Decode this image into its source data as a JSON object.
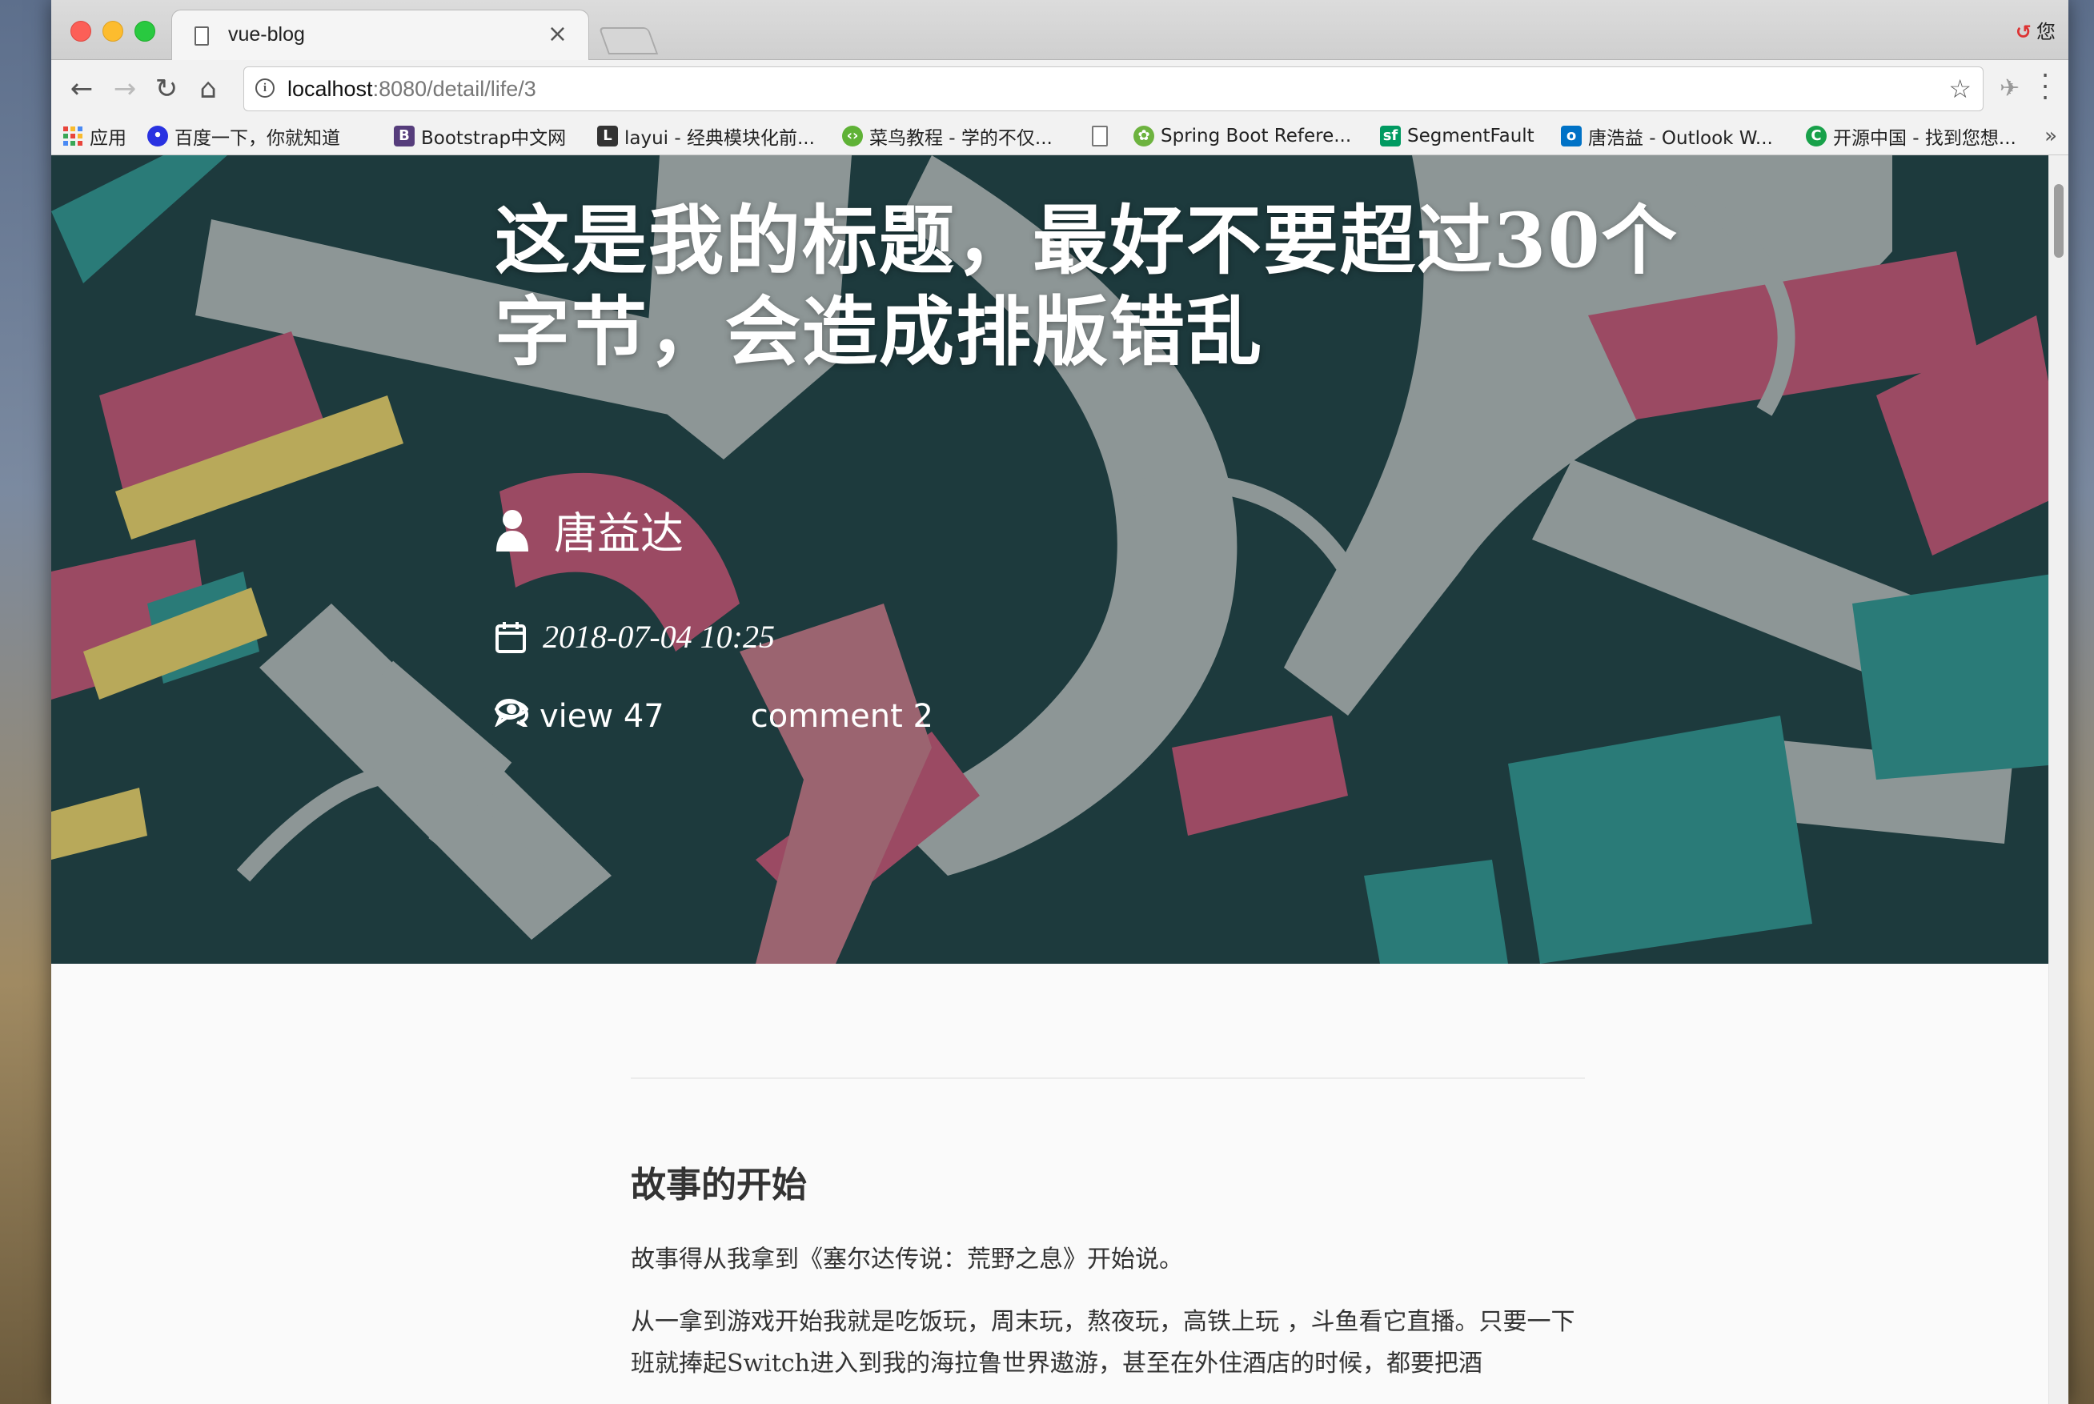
{
  "browser": {
    "tab_title": "vue-blog",
    "tab_close": "×",
    "top_right_label": "您",
    "url_host": "localhost",
    "url_path": ":8080/detail/life/3"
  },
  "bookmarks": [
    {
      "label": "应用",
      "icon": "apps-grid-icon",
      "color": "#e8453c"
    },
    {
      "label": "百度一下，你就知道",
      "icon": "baidu-paw-icon",
      "color": "#2932e1"
    },
    {
      "label": "Bootstrap中文网",
      "icon": "bootstrap-icon",
      "color": "#563d7c"
    },
    {
      "label": "layui - 经典模块化前...",
      "icon": "layui-icon",
      "color": "#333333"
    },
    {
      "label": "菜鸟教程 - 学的不仅...",
      "icon": "runoob-icon",
      "color": "#5fb236"
    },
    {
      "label": "",
      "icon": "blank-page-icon",
      "color": "#ffffff"
    },
    {
      "label": "Spring Boot Refere...",
      "icon": "spring-icon",
      "color": "#6db33f"
    },
    {
      "label": "SegmentFault",
      "icon": "segmentfault-icon",
      "color": "#009a61"
    },
    {
      "label": "唐浩益 - Outlook W...",
      "icon": "outlook-icon",
      "color": "#0072c6"
    },
    {
      "label": "开源中国 - 找到您想...",
      "icon": "oschina-icon",
      "color": "#18a14a"
    }
  ],
  "bookmarks_more": "»",
  "post": {
    "title": "这是我的标题，最好不要超过30个字节，会造成排版错乱",
    "author": "唐益达",
    "date": "2018-07-04 10:25",
    "views_label": "view 47",
    "comments_label": "comment 2"
  },
  "article": {
    "heading": "故事的开始",
    "paragraphs": [
      "故事得从我拿到《塞尔达传说：荒野之息》开始说。",
      "从一拿到游戏开始我就是吃饭玩，周末玩，熬夜玩，高铁上玩 ，斗鱼看它直播。只要一下班就捧起Switch进入到我的海拉鲁世界遨游，甚至在外住酒店的时候，都要把酒"
    ]
  },
  "colors": {
    "hero_dark": "#1d3a3d",
    "hero_gray": "#8d9696",
    "hero_pink": "#9b4a63",
    "hero_teal": "#2a7b78",
    "hero_yellow": "#b8a95a"
  }
}
